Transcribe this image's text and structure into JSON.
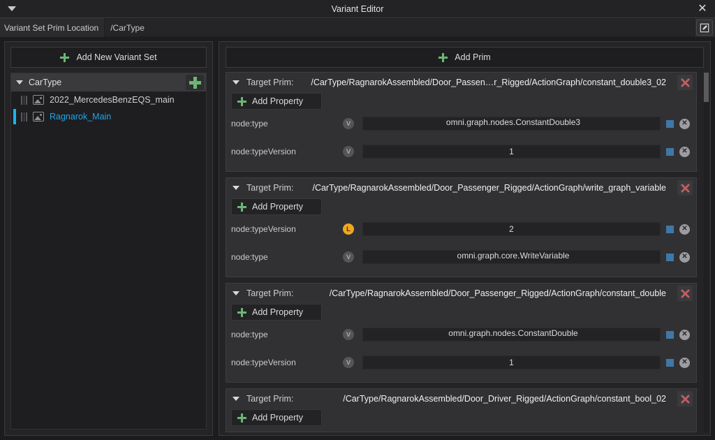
{
  "window": {
    "title": "Variant Editor",
    "menu_icon": "triangle-down-icon",
    "close_icon": "close-icon"
  },
  "location_bar": {
    "label": "Variant Set Prim Location",
    "value": "/CarType",
    "edit_icon": "pencil-edit-icon"
  },
  "sidebar": {
    "add_variant_set_button": "Add New Variant Set",
    "variant_set": {
      "name": "CarType",
      "add_icon": "plus-icon",
      "expand_icon": "triangle-down-icon",
      "variants": [
        {
          "label": "2022_MercedesBenzEQS_main",
          "icon": "image-icon",
          "selected": false
        },
        {
          "label": "Ragnarok_Main",
          "icon": "image-icon",
          "selected": true
        }
      ]
    }
  },
  "main": {
    "add_prim_button": "Add Prim",
    "target_prim_label": "Target Prim:",
    "add_property_label": "Add Property",
    "delete_icon": "red-x-icon",
    "clear_icon": "circle-x-icon",
    "color_swatch": "#3f78a8",
    "prims": [
      {
        "path": "/CarType/RagnarokAssembled/Door_Passen…r_Rigged/ActionGraph/constant_double3_02",
        "properties": [
          {
            "name": "node:type",
            "badge": "V",
            "badge_kind": "v",
            "value": "omni.graph.nodes.ConstantDouble3",
            "align": "left"
          },
          {
            "name": "node:typeVersion",
            "badge": "V",
            "badge_kind": "v",
            "value": "1",
            "align": "center"
          }
        ]
      },
      {
        "path": "/CarType/RagnarokAssembled/Door_Passenger_Rigged/ActionGraph/write_graph_variable",
        "properties": [
          {
            "name": "node:typeVersion",
            "badge": "L",
            "badge_kind": "l",
            "value": "2",
            "align": "center"
          },
          {
            "name": "node:type",
            "badge": "V",
            "badge_kind": "v",
            "value": "omni.graph.core.WriteVariable",
            "align": "left"
          }
        ]
      },
      {
        "path": "/CarType/RagnarokAssembled/Door_Passenger_Rigged/ActionGraph/constant_double",
        "properties": [
          {
            "name": "node:type",
            "badge": "V",
            "badge_kind": "v",
            "value": "omni.graph.nodes.ConstantDouble",
            "align": "left"
          },
          {
            "name": "node:typeVersion",
            "badge": "V",
            "badge_kind": "v",
            "value": "1",
            "align": "center"
          }
        ]
      },
      {
        "path": "/CarType/RagnarokAssembled/Door_Driver_Rigged/ActionGraph/constant_bool_02",
        "properties": []
      }
    ]
  }
}
